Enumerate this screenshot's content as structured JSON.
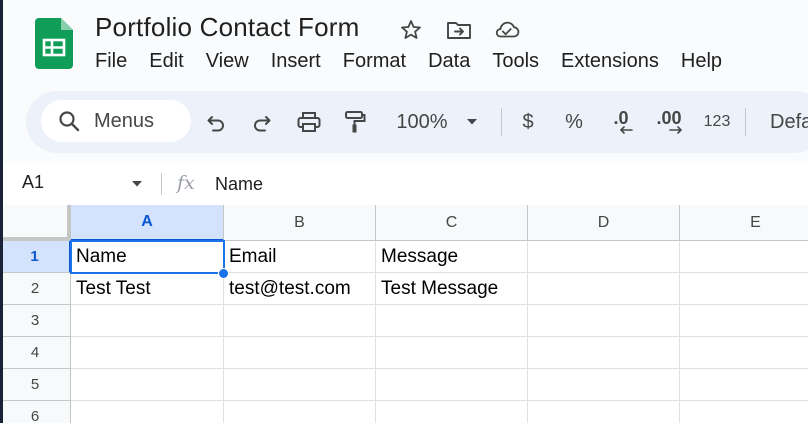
{
  "app": {
    "title": "Portfolio Contact Form",
    "brand_color": "#0f9d58",
    "accent_color": "#1a73e8"
  },
  "menubar": {
    "items": [
      "File",
      "Edit",
      "View",
      "Insert",
      "Format",
      "Data",
      "Tools",
      "Extensions",
      "Help"
    ]
  },
  "toolbar": {
    "search_label": "Menus",
    "zoom": "100%",
    "currency": "$",
    "percent": "%",
    "decrease_decimal": ".0",
    "increase_decimal": ".00",
    "number_format": "123",
    "font_truncated": "Defa"
  },
  "formula_bar": {
    "cell_ref": "A1",
    "fx": "fx",
    "value": "Name"
  },
  "grid": {
    "columns": [
      "A",
      "B",
      "C",
      "D",
      "E"
    ],
    "rows": [
      "1",
      "2",
      "3",
      "4",
      "5",
      "6"
    ],
    "cells": [
      [
        "Name",
        "Email",
        "Message",
        "",
        ""
      ],
      [
        "Test Test",
        "test@test.com",
        "Test Message",
        "",
        ""
      ],
      [
        "",
        "",
        "",
        "",
        ""
      ],
      [
        "",
        "",
        "",
        "",
        ""
      ],
      [
        "",
        "",
        "",
        "",
        ""
      ],
      [
        "",
        "",
        "",
        "",
        ""
      ]
    ],
    "selected_cell": "A1"
  }
}
